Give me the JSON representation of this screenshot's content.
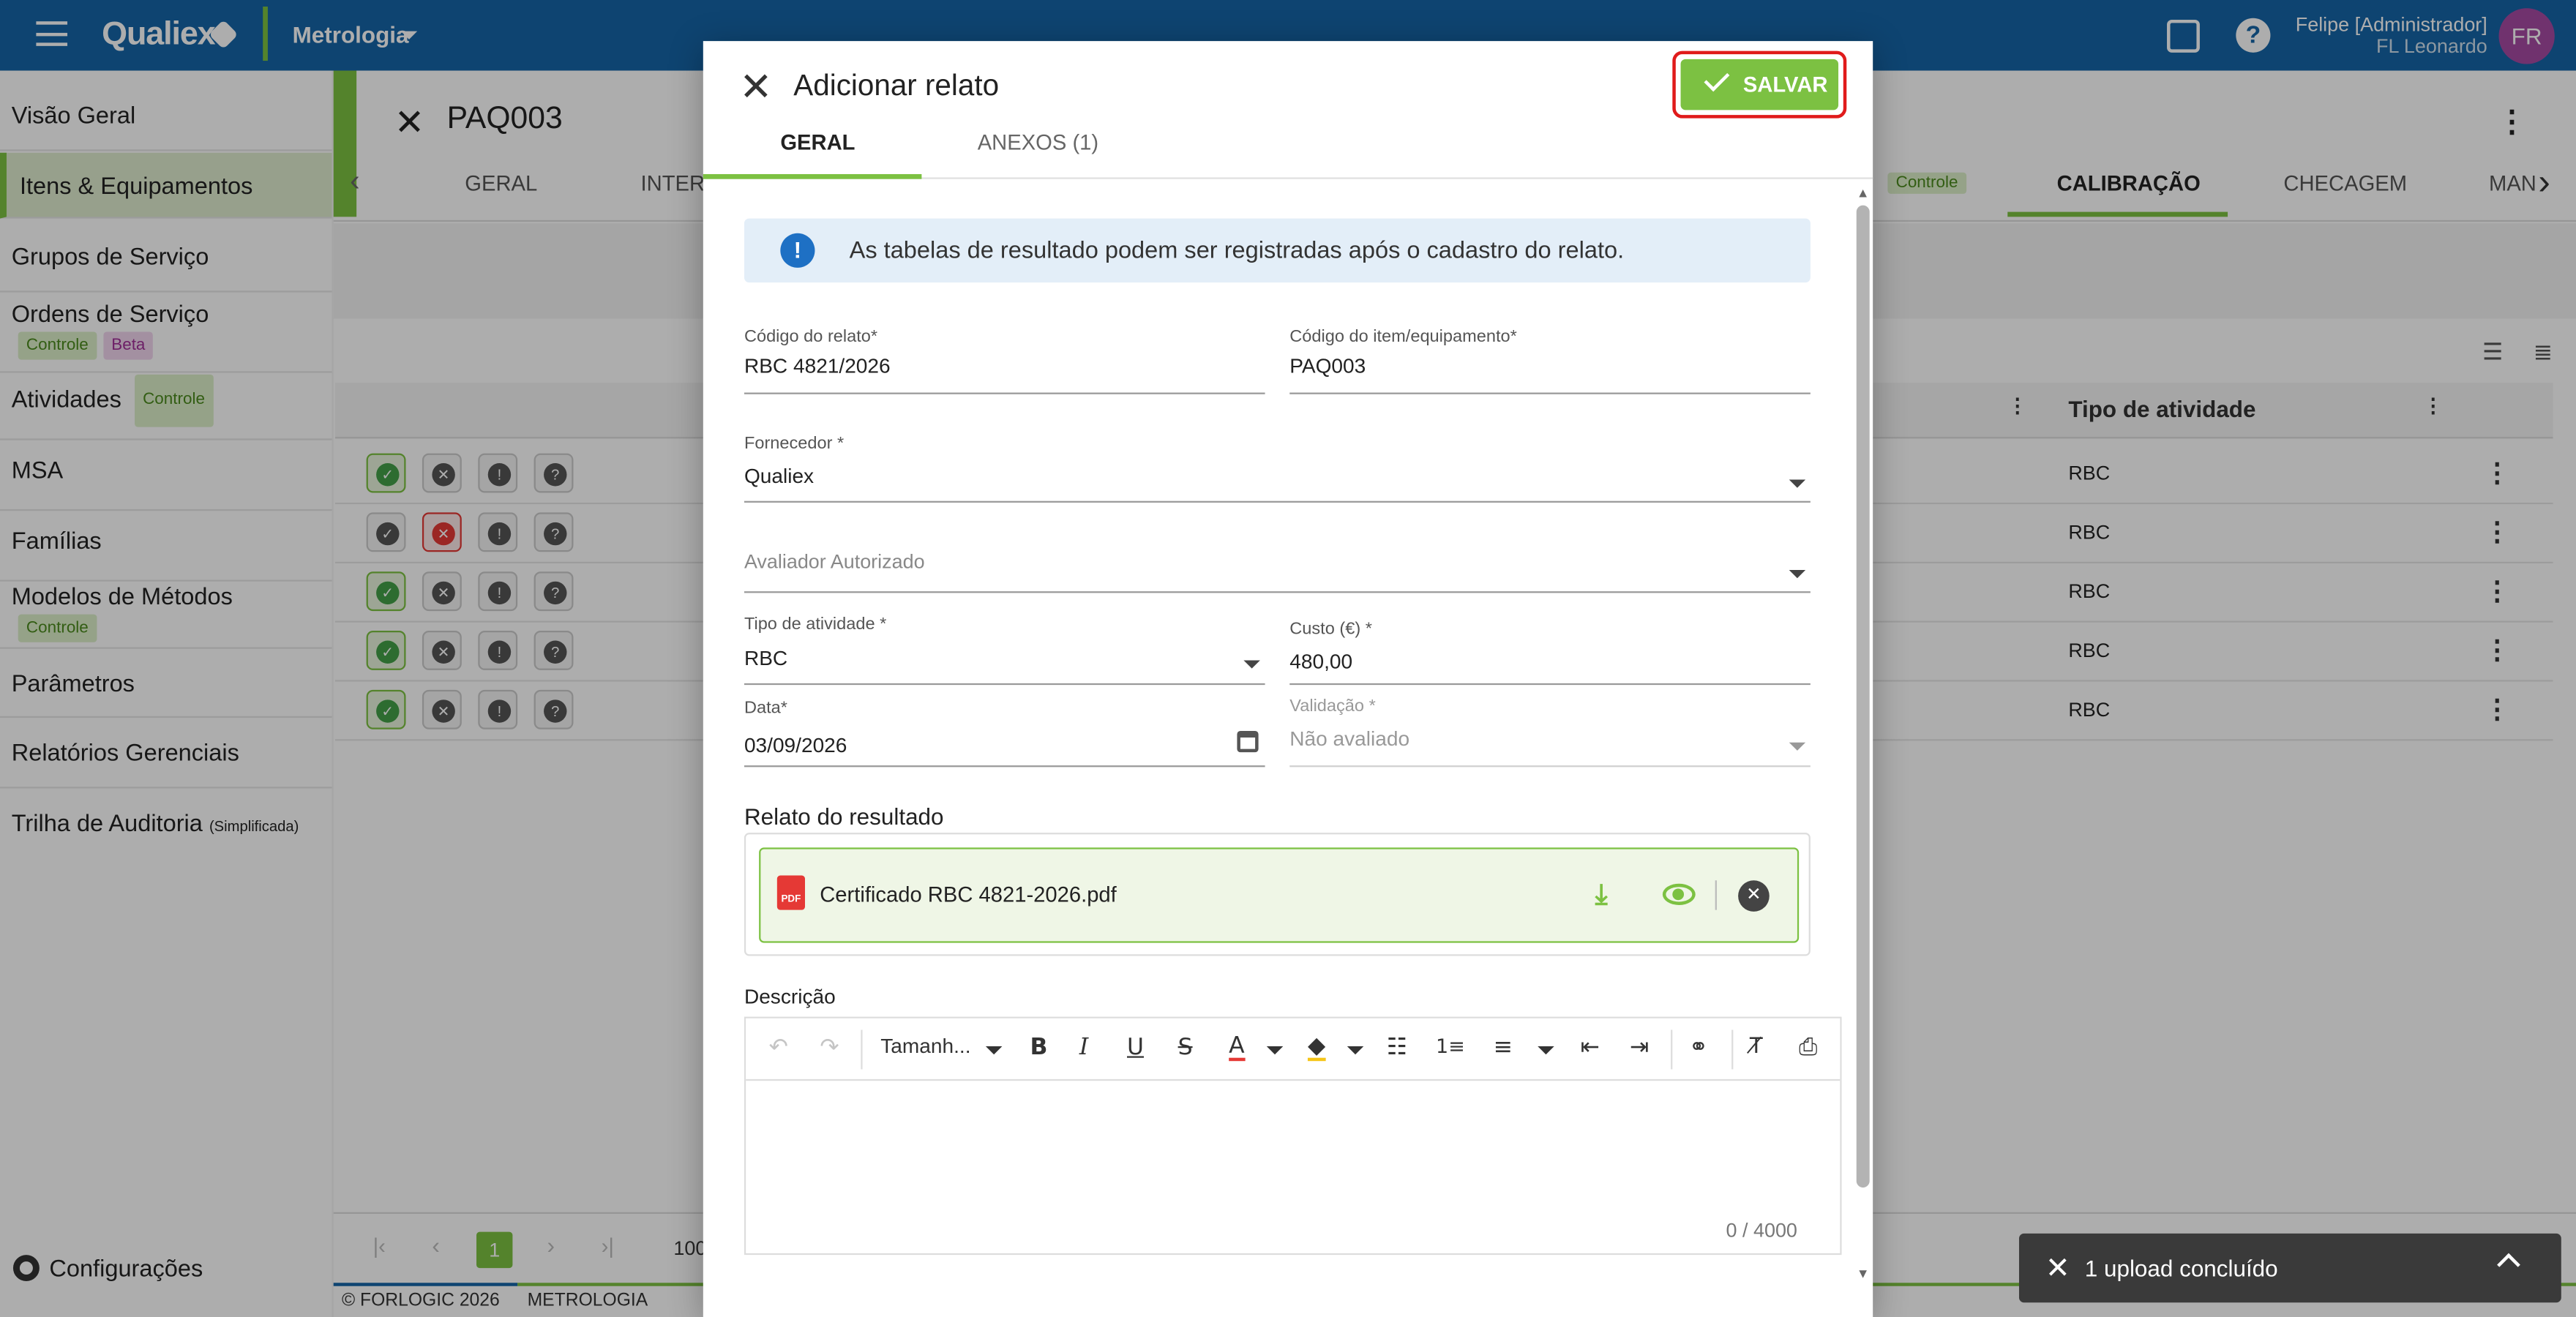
{
  "header": {
    "logo": "Qualiex",
    "module": "Metrologia",
    "user_name": "Felipe [Administrador]",
    "user_company": "FL Leonardo",
    "avatar_initials": "FR",
    "colors": {
      "bar": "#1565a7",
      "accent": "#7cc142"
    }
  },
  "sidebar": {
    "items": [
      {
        "label": "Visão Geral"
      },
      {
        "label": "Itens & Equipamentos",
        "active": true
      },
      {
        "label": "Grupos de Serviço"
      },
      {
        "label": "Ordens de Serviço",
        "tags": [
          "Controle",
          "Beta"
        ]
      },
      {
        "label": "Atividades",
        "tags": [
          "Controle"
        ]
      },
      {
        "label": "MSA"
      },
      {
        "label": "Famílias"
      },
      {
        "label": "Modelos de Métodos",
        "tags": [
          "Controle"
        ]
      },
      {
        "label": "Parâmetros"
      },
      {
        "label": "Relatórios Gerenciais"
      },
      {
        "label": "Trilha de Auditoria",
        "note": "(Simplificada)"
      }
    ],
    "settings_label": "Configurações"
  },
  "background": {
    "title": "PAQ003",
    "tabs": [
      "GERAL",
      "INTERV",
      "Controle",
      "CALIBRAÇÃO",
      "CHECAGEM",
      "MAN"
    ],
    "active_tab": "CALIBRAÇÃO",
    "column_header": "Tipo de atividade",
    "rows": [
      {
        "status": "ok",
        "type": "RBC"
      },
      {
        "status": "bad",
        "type": "RBC"
      },
      {
        "status": "ok",
        "type": "RBC"
      },
      {
        "status": "ok",
        "type": "RBC"
      },
      {
        "status": "ok",
        "type": "RBC"
      }
    ],
    "current_page": "1",
    "page_size_partial": "100",
    "footer_copyright": "© FORLOGIC 2026",
    "footer_module": "METROLOGIA"
  },
  "modal": {
    "title": "Adicionar relato",
    "save_label": "SALVAR",
    "tabs": [
      "GERAL",
      "ANEXOS (1)"
    ],
    "info_text": "As tabelas de resultado podem ser registradas após o cadastro do relato.",
    "fields": {
      "report_code": {
        "label": "Código do relato*",
        "value": "RBC 4821/2026"
      },
      "item_code": {
        "label": "Código do item/equipamento*",
        "value": "PAQ003"
      },
      "supplier": {
        "label": "Fornecedor *",
        "value": "Qualiex"
      },
      "evaluator": {
        "placeholder": "Avaliador Autorizado"
      },
      "activity_type": {
        "label": "Tipo de atividade *",
        "value": "RBC"
      },
      "cost": {
        "label": "Custo (€) *",
        "value": "480,00"
      },
      "date": {
        "label": "Data*",
        "value": "03/09/2026"
      },
      "validation": {
        "label": "Validação *",
        "value": "Não avaliado"
      }
    },
    "result_section_title": "Relato do resultado",
    "attachment": {
      "file_name": "Certificado RBC 4821-2026.pdf",
      "icon_text": "PDF"
    },
    "description_label": "Descrição",
    "editor": {
      "font_size_label": "Tamanh...",
      "counter": "0 / 4000"
    }
  },
  "toast": {
    "text": "1 upload concluído"
  }
}
